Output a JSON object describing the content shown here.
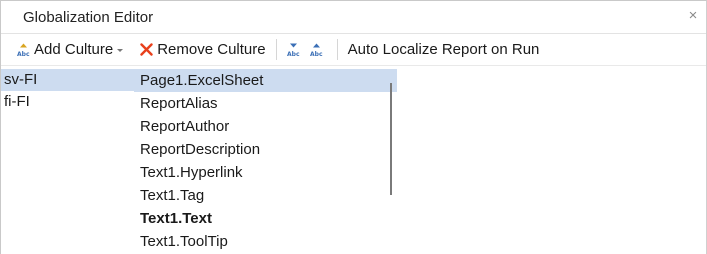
{
  "window": {
    "title": "Globalization Editor",
    "close_glyph": "×"
  },
  "toolbar": {
    "add_culture_label": "Add Culture",
    "remove_culture_label": "Remove Culture",
    "auto_localize_label": "Auto Localize Report on Run",
    "icons": [
      "add-culture-icon",
      "remove-culture-icon",
      "move-down-icon",
      "move-up-icon"
    ]
  },
  "cultures": [
    {
      "label": "sv-FI",
      "selected": true
    },
    {
      "label": "fi-FI",
      "selected": false
    }
  ],
  "keys": [
    {
      "label": "Page1.ExcelSheet",
      "selected": true,
      "bold": false
    },
    {
      "label": "ReportAlias",
      "selected": false,
      "bold": false
    },
    {
      "label": "ReportAuthor",
      "selected": false,
      "bold": false
    },
    {
      "label": "ReportDescription",
      "selected": false,
      "bold": false
    },
    {
      "label": "Text1.Hyperlink",
      "selected": false,
      "bold": false
    },
    {
      "label": "Text1.Tag",
      "selected": false,
      "bold": false
    },
    {
      "label": "Text1.Text",
      "selected": false,
      "bold": true
    },
    {
      "label": "Text1.ToolTip",
      "selected": false,
      "bold": false
    }
  ],
  "colors": {
    "selection": "#cddcf0",
    "remove_icon": "#e8401c",
    "abc_icon_blue": "#3b6fb6",
    "abc_icon_gold": "#d9a521"
  }
}
